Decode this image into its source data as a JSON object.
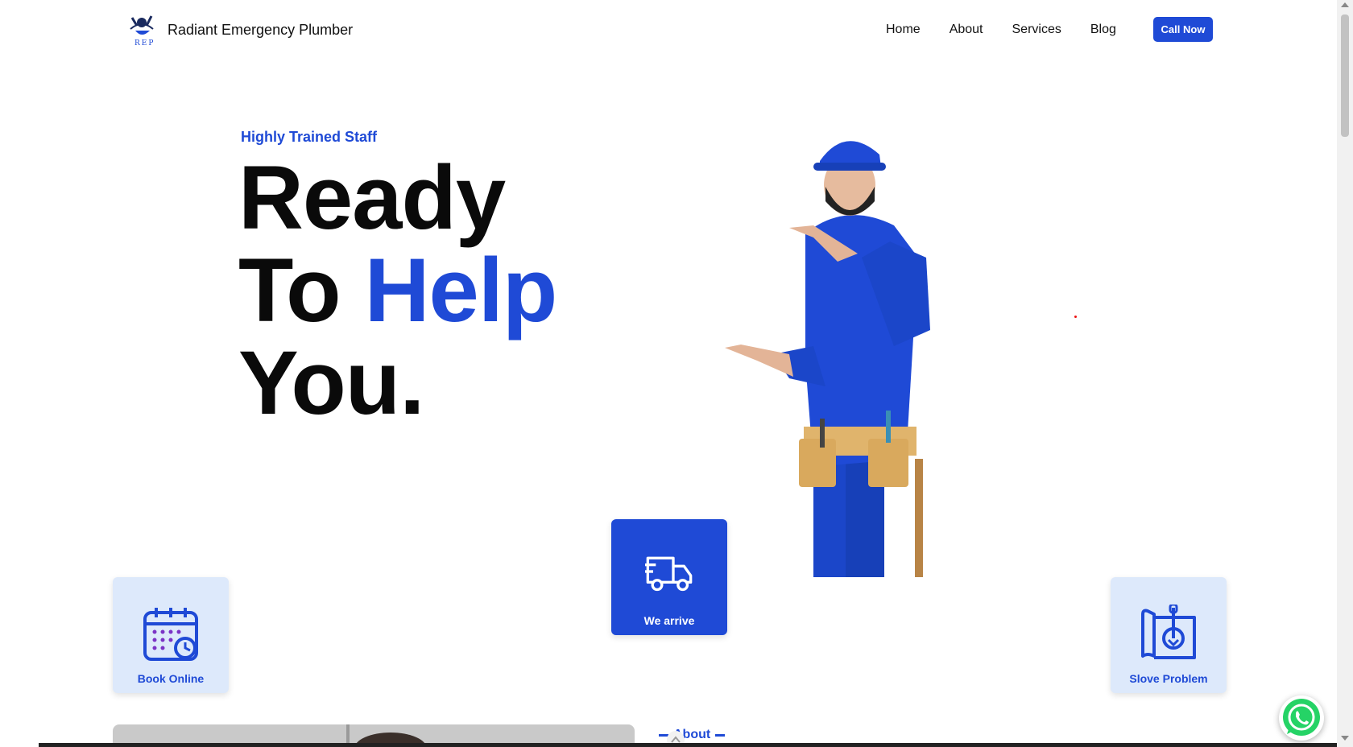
{
  "navbar": {
    "brand_name": "Radiant Emergency Plumber",
    "logo_text": "REP",
    "links": [
      "Home",
      "About",
      "Services",
      "Blog"
    ],
    "cta_label": "Call Now"
  },
  "hero": {
    "eyebrow": "Highly Trained Staff",
    "line1": "Ready",
    "line2_start": "To",
    "line2_accent": "Help",
    "line3": "You."
  },
  "cards": {
    "book": "Book Online",
    "arrive": "We arrive",
    "solve": "Slove Problem"
  },
  "about": {
    "tag": "About"
  },
  "colors": {
    "accent": "#1f4ad6",
    "card_light": "#dde9fb",
    "whatsapp": "#25d366"
  },
  "icons": [
    "calendar-icon",
    "truck-icon",
    "repair-icon",
    "whatsapp-icon",
    "arrow-up-icon"
  ]
}
